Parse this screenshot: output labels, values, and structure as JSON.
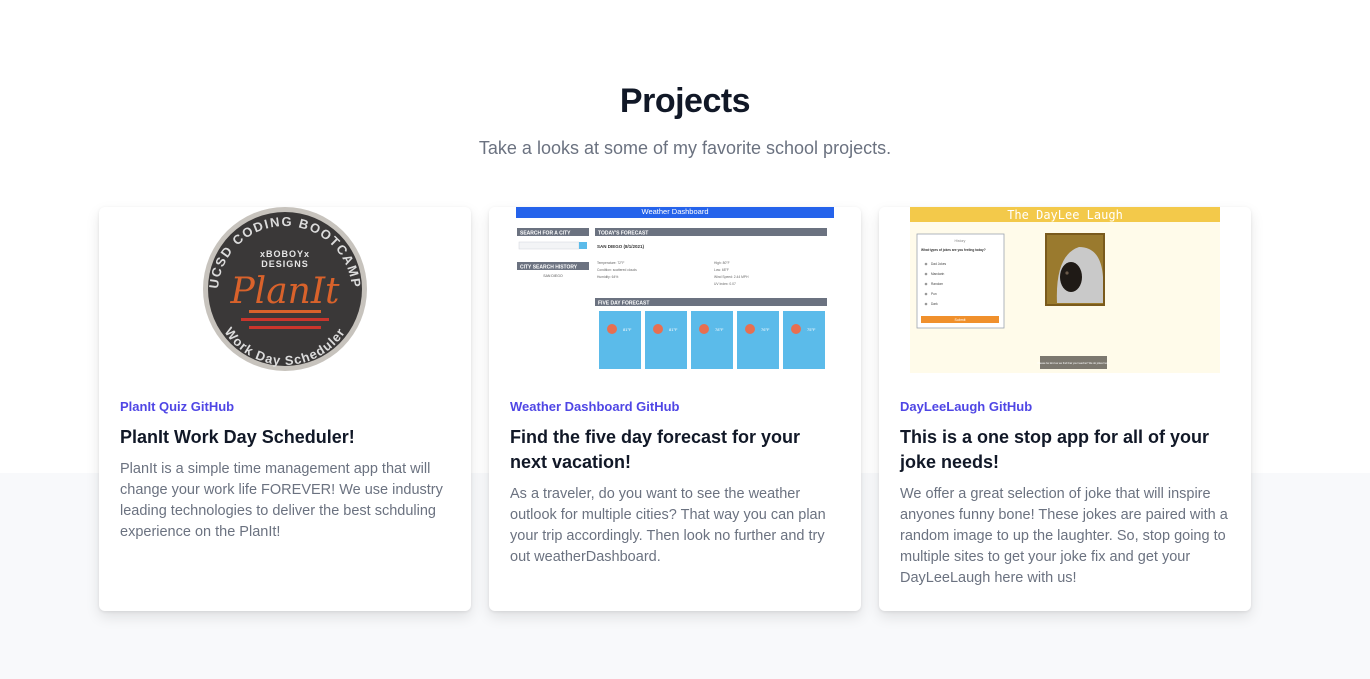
{
  "section": {
    "title": "Projects",
    "subtitle": "Take a looks at some of my favorite school projects."
  },
  "projects": [
    {
      "link_label": "PlanIt Quiz GitHub",
      "heading": "PlanIt Work Day Scheduler!",
      "description": "PlanIt is a simple time management app that will change your work life FOREVER! We use industry leading technologies to deliver the best schduling experience on the PlanIt!",
      "image": {
        "logo_top_text": "UCSD CODING BOOTCAMP",
        "logo_bottom_text": "Work Day Scheduler",
        "logo_brand_1": "xBOBOYx",
        "logo_brand_2": "DESIGNS",
        "logo_main": "PlanIt",
        "colors": {
          "ring": "#c7c3bd",
          "disc": "#3a3838",
          "accent": "#d9622b"
        }
      }
    },
    {
      "link_label": "Weather Dashboard GitHub",
      "heading": "Find the five day forecast for your next vacation!",
      "description": "As a traveler, do you want to see the weather outlook for multiple cities? That way you can plan your trip accordingly. Then look no further and try out weatherDashboard.",
      "image": {
        "header": "Weather Dashboard",
        "search_label": "SEARCH FOR A CITY",
        "history_label": "CITY SEARCH HISTORY",
        "history_item": "SAN DIEGO",
        "today_label": "TODAY'S FORECAST",
        "city_line": "SAN DIEGO (8/1/2021)",
        "left_stats": [
          "Temperature: 72°F",
          "Condition: scattered clouds",
          "Humidity: 64%"
        ],
        "right_stats": [
          "High: 80°F",
          "Low: 68°F",
          "Wind Speed: 2.44 MPH",
          "UV Index: 0.07"
        ],
        "five_day_label": "FIVE DAY FORECAST",
        "forecast_temps": [
          "81°F",
          "81°F",
          "78°F",
          "76°F",
          "75°F"
        ],
        "colors": {
          "header": "#2563eb",
          "label_bar": "#6b7280",
          "tile": "#5bbbea",
          "sun": "#e76f51"
        }
      }
    },
    {
      "link_label": "DayLeeLaugh GitHub",
      "heading": "This is a one stop app for all of your joke needs!",
      "description": "We offer a great selection of joke that will inspire anyones funny bone! These jokes are paired with a random image to up the laughter. So, stop going to multiple sites to get your joke fix and get your DayLeeLaugh here with us!",
      "image": {
        "banner": "The DayLee Laugh",
        "quiz_tab": "History",
        "quiz_question": "What types of jokes are you feeling today?",
        "options": [
          "Dad Jokes",
          "Mandarin",
          "Random",
          "Pun",
          "Dark"
        ],
        "submit_label": "Submit",
        "footer_note": "Please be kind as we find that your teacher! We do jokes here.",
        "colors": {
          "banner": "#f3c94a",
          "background": "#fffbea",
          "submit": "#f0902c",
          "note": "#7c786f"
        }
      }
    }
  ]
}
